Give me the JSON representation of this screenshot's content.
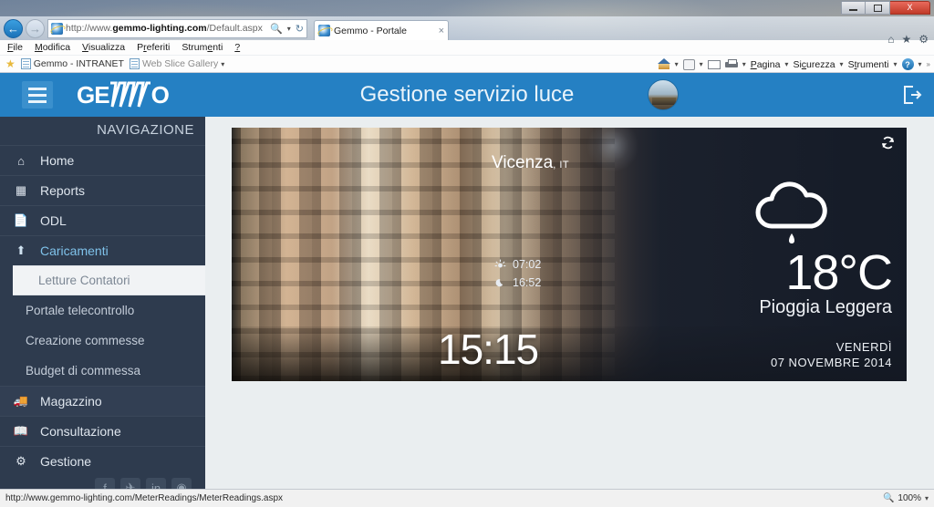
{
  "window": {
    "minimize_label": "Riduci a icona",
    "restore_label": "Ripristino",
    "close_label": "X"
  },
  "browser": {
    "back_icon": "back-arrow-icon",
    "forward_icon": "forward-arrow-icon",
    "address": {
      "protocol": "http://www.",
      "domain": "gemmo-lighting.com",
      "path": "/Default.aspx",
      "search_icon": "search-icon",
      "refresh_icon": "refresh-icon"
    },
    "tab": {
      "title": "Gemmo - Portale",
      "close": "×"
    },
    "menu": [
      {
        "label": "File",
        "accel": "F"
      },
      {
        "label": "Modifica",
        "accel": "M"
      },
      {
        "label": "Visualizza",
        "accel": "V"
      },
      {
        "label": "Preferiti",
        "accel": "r"
      },
      {
        "label": "Strumenti",
        "accel": "e"
      },
      {
        "label": "?",
        "accel": "?"
      }
    ],
    "favorites": [
      {
        "label": "Gemmo - INTRANET"
      },
      {
        "label": "Web Slice Gallery"
      }
    ],
    "command_bar": [
      {
        "label": "",
        "icon": "home-icon"
      },
      {
        "label": "",
        "icon": "feeds-icon"
      },
      {
        "label": "",
        "icon": "mail-icon"
      },
      {
        "label": "",
        "icon": "print-icon"
      },
      {
        "label": "Pagina",
        "accel": "P",
        "icon": "page-menu"
      },
      {
        "label": "Sicurezza",
        "accel": "c",
        "icon": "security-menu"
      },
      {
        "label": "Strumenti",
        "accel": "t",
        "icon": "tools-menu"
      },
      {
        "label": "",
        "icon": "help-icon"
      }
    ],
    "right_icons": [
      "home-icon",
      "favorites-star-icon",
      "settings-gear-icon"
    ]
  },
  "app": {
    "logo_text_a": "GE",
    "logo_text_b": "O",
    "title": "Gestione servizio luce",
    "menu_toggle_icon": "hamburger-icon",
    "avatar_icon": "user-avatar",
    "logout_icon": "logout-icon"
  },
  "sidebar": {
    "heading": "NAVIGAZIONE",
    "items": [
      {
        "label": "Home",
        "icon": "home-icon",
        "active": false
      },
      {
        "label": "Reports",
        "icon": "chart-bar-icon",
        "active": false
      },
      {
        "label": "ODL",
        "icon": "document-icon",
        "active": false
      },
      {
        "label": "Caricamenti",
        "icon": "upload-icon",
        "active": true
      },
      {
        "label": "Magazzino",
        "icon": "truck-icon",
        "active": false
      },
      {
        "label": "Consultazione",
        "icon": "book-icon",
        "active": false
      },
      {
        "label": "Gestione",
        "icon": "gears-icon",
        "active": false
      }
    ],
    "submenu": [
      {
        "label": "Letture Contatori",
        "hovered": true
      },
      {
        "label": "Portale telecontrollo",
        "hovered": false
      },
      {
        "label": "Creazione commesse",
        "hovered": false
      },
      {
        "label": "Budget di commessa",
        "hovered": false
      }
    ],
    "social": [
      {
        "icon": "facebook-icon",
        "glyph": "f"
      },
      {
        "icon": "twitter-icon",
        "glyph": "✉"
      },
      {
        "icon": "linkedin-icon",
        "glyph": "in"
      },
      {
        "icon": "rss-icon",
        "glyph": "◎"
      }
    ]
  },
  "weather": {
    "city": "Vicenza",
    "country": ", IT",
    "sunrise": "07:02",
    "sunset": "16:52",
    "sunrise_icon": "sunrise-icon",
    "sunset_icon": "moon-icon",
    "temperature": "18°C",
    "condition": "Pioggia Leggera",
    "condition_icon": "rain-cloud-icon",
    "clock": "15:15",
    "weekday": "VENERDÌ",
    "date": "07 NOVEMBRE 2014",
    "refresh_icon": "refresh-icon"
  },
  "statusbar": {
    "url": "http://www.gemmo-lighting.com/MeterReadings/MeterReadings.aspx",
    "zoom": "100%",
    "zoom_icon": "magnifier-icon",
    "zoom_caret": "▾"
  },
  "colors": {
    "header_blue": "#2580c3",
    "sidebar_navy": "#2e3b4e",
    "content_bg": "#eaeef0",
    "active_link": "#7fc2ea",
    "close_red": "#c03a28"
  }
}
